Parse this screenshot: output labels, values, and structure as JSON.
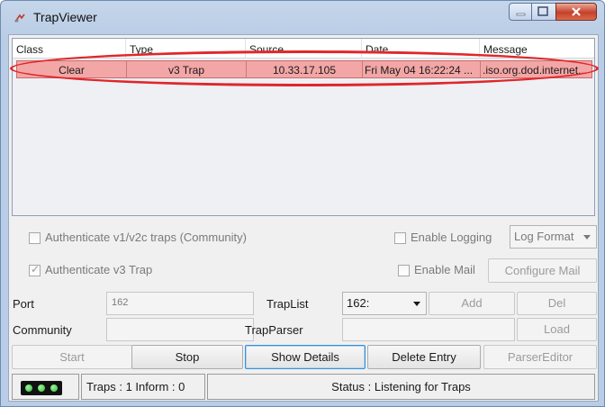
{
  "window": {
    "title": "TrapViewer"
  },
  "table": {
    "columns": [
      "Class",
      "Type",
      "Source",
      "Date",
      "Message"
    ],
    "rows": [
      {
        "class": "Clear",
        "type": "v3 Trap",
        "source": "10.33.17.105",
        "date": "Fri May 04 16:22:24 ...",
        "message": ".iso.org.dod.internet..."
      }
    ],
    "selected_row_color": "#f3a6a6",
    "annotation_color": "#e0262a"
  },
  "options": {
    "auth_v1v2c_label": "Authenticate v1/v2c traps (Community)",
    "auth_v1v2c_checked": false,
    "enable_logging_label": "Enable Logging",
    "enable_logging_checked": false,
    "log_format_value": "Log Format",
    "auth_v3_label": "Authenticate v3 Trap",
    "auth_v3_checked": true,
    "enable_mail_label": "Enable Mail",
    "enable_mail_checked": false,
    "configure_mail_label": "Configure Mail"
  },
  "config": {
    "port_label": "Port",
    "port_value": "162",
    "community_label": "Community",
    "community_value": "",
    "traplist_label": "TrapList",
    "traplist_value": "162:",
    "add_label": "Add",
    "del_label": "Del",
    "trapparser_label": "TrapParser",
    "trapparser_value": "",
    "load_label": "Load"
  },
  "actions": {
    "start": "Start",
    "stop": "Stop",
    "show_details": "Show Details",
    "delete_entry": "Delete Entry",
    "parser_editor": "ParserEditor"
  },
  "status": {
    "counts": "Traps : 1 Inform : 0",
    "message": "Status : Listening for Traps",
    "led_color": "#2fbf3a"
  }
}
